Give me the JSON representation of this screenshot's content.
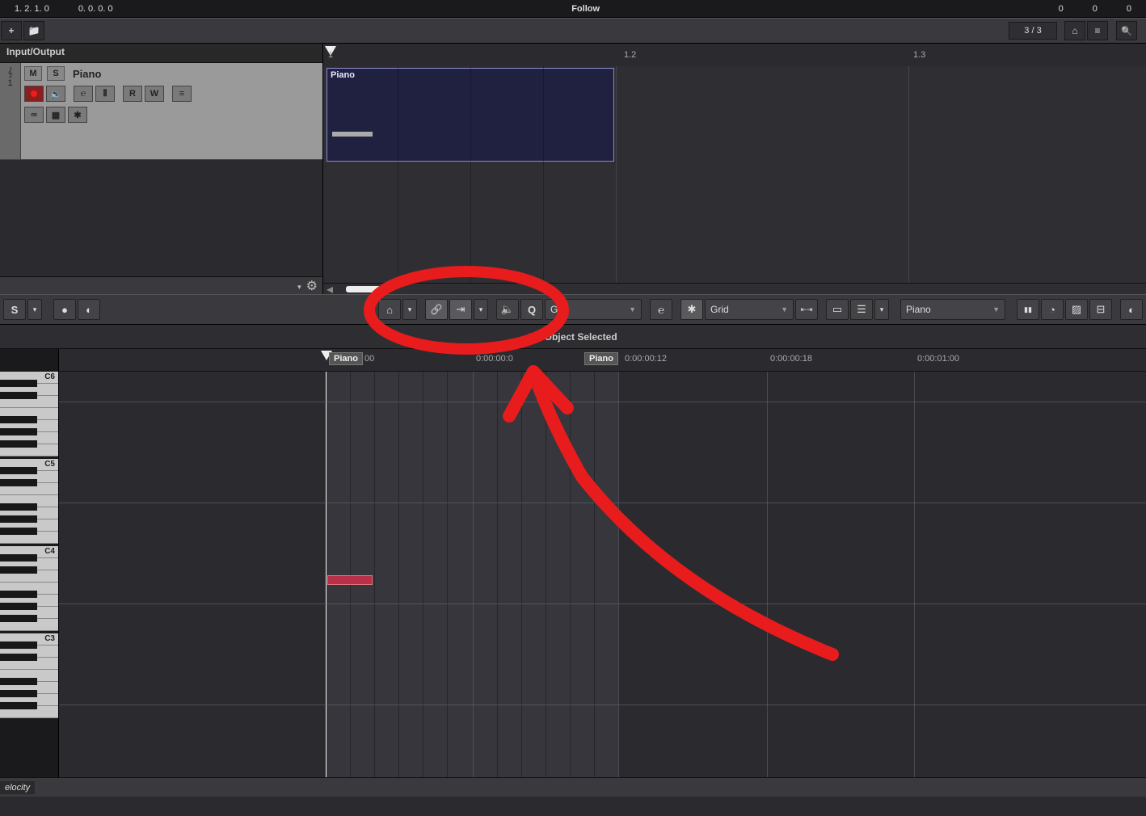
{
  "top": {
    "time1": "1. 2. 1.  0",
    "time2": "0.  0. 0.  0",
    "follow": "Follow",
    "zero1": "0",
    "zero2": "0",
    "zero3": "0"
  },
  "toolbar1": {
    "counter": "3 / 3"
  },
  "inspector": {
    "header": "Input/Output"
  },
  "track": {
    "number": "1",
    "mute": "M",
    "solo": "S",
    "name": "Piano",
    "btns": {
      "e": "℮",
      "r": "R",
      "w": "W"
    },
    "row2": {
      "loop": "∞",
      "freeze": "❄",
      "star": "✱"
    }
  },
  "timeline": {
    "marker1": "1",
    "marker2": "1.2",
    "marker3": "1.3",
    "clip_label": "Piano"
  },
  "toolbar2": {
    "grid1": "Grid",
    "grid2": "Grid",
    "preset": "Piano"
  },
  "status": {
    "msg": "No Object Selected"
  },
  "editor_ruler": {
    "part1": "Piano",
    "t00": "00",
    "t06": "0:00:00:0",
    "part2": "Piano",
    "t12": "0:00:00:12",
    "t18": "0:00:00:18",
    "t100": "0:00:01:00"
  },
  "keys": {
    "c6": "C6",
    "c5": "C5",
    "c4": "C4",
    "c3": "C3"
  },
  "bottom": {
    "velocity": "elocity"
  }
}
